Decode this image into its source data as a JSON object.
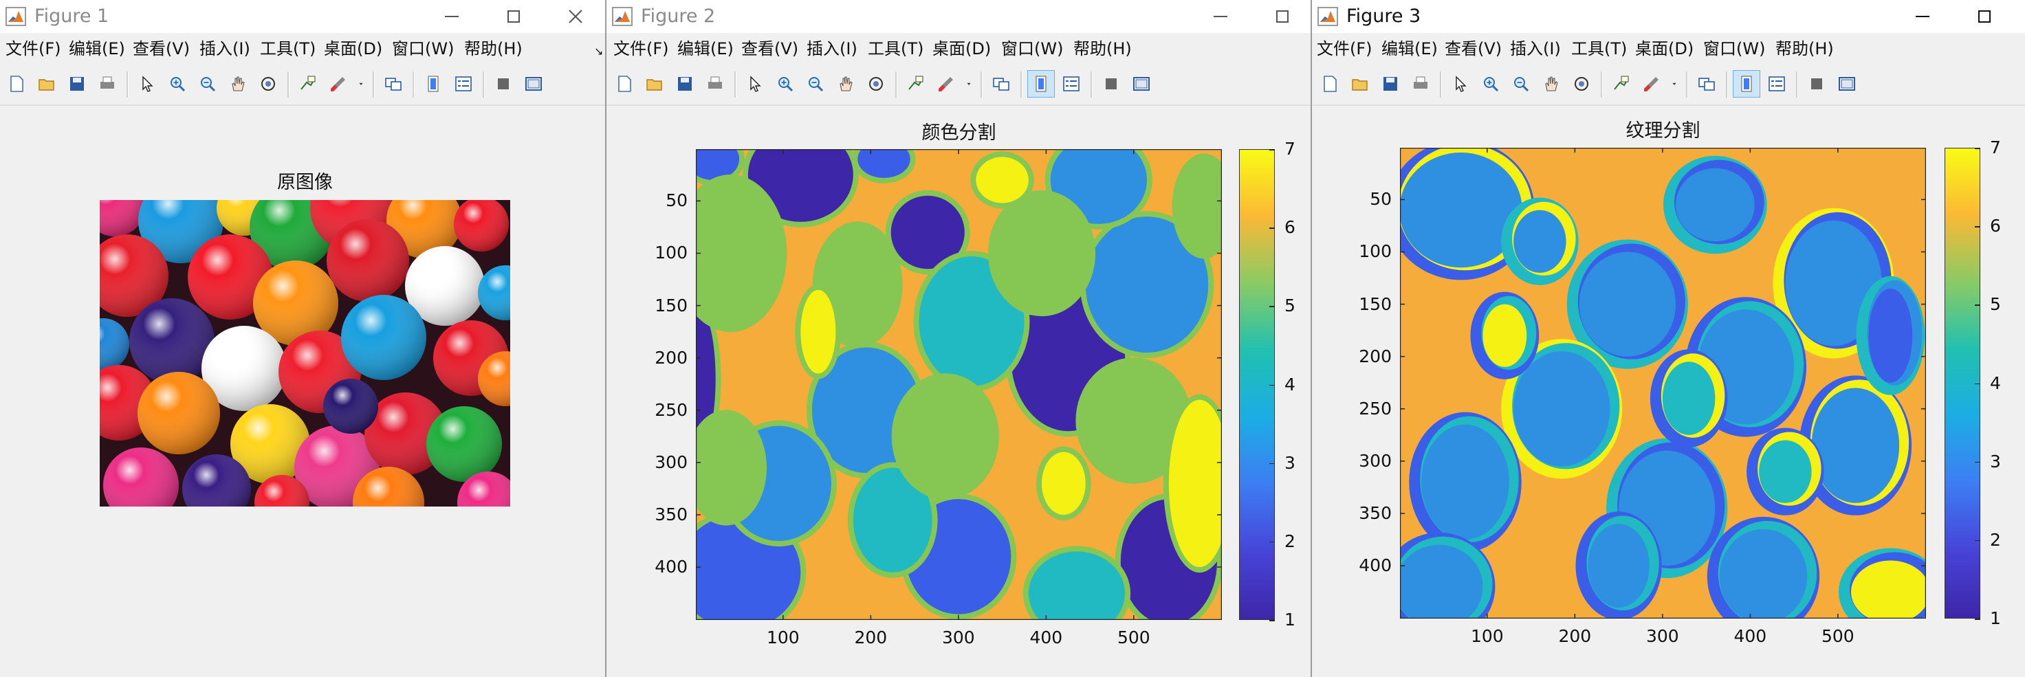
{
  "windows": {
    "figure1": {
      "title": "Figure 1",
      "state": "inactive",
      "menu": [
        "文件(F)",
        "编辑(E)",
        "查看(V)",
        "插入(I)",
        "工具(T)",
        "桌面(D)",
        "窗口(W)",
        "帮助(H)"
      ],
      "axes_title": "原图像"
    },
    "figure2": {
      "title": "Figure 2",
      "state": "inactive",
      "menu": [
        "文件(F)",
        "编辑(E)",
        "查看(V)",
        "插入(I)",
        "工具(T)",
        "桌面(D)",
        "窗口(W)",
        "帮助(H)"
      ],
      "axes_title": "颜色分割",
      "colorbar_ticks": [
        "7",
        "6",
        "5",
        "4",
        "3",
        "2",
        "1"
      ]
    },
    "figure3": {
      "title": "Figure 3",
      "state": "active",
      "menu": [
        "文件(F)",
        "编辑(E)",
        "查看(V)",
        "插入(I)",
        "工具(T)",
        "桌面(D)",
        "窗口(W)",
        "帮助(H)"
      ],
      "axes_title": "纹理分割",
      "colorbar_ticks": [
        "7",
        "6",
        "5",
        "4",
        "3",
        "2",
        "1"
      ]
    }
  },
  "toolbar_icons": [
    "new-figure-icon",
    "open-file-icon",
    "save-icon",
    "print-icon",
    "pointer-icon",
    "zoom-in-icon",
    "zoom-out-icon",
    "pan-icon",
    "rotate-3d-icon",
    "data-cursor-icon",
    "brush-icon",
    "brush-dropdown-icon",
    "link-plot-icon",
    "insert-colorbar-icon",
    "insert-legend-icon",
    "hide-plot-tools-icon",
    "show-plot-tools-icon"
  ],
  "colormap": {
    "1": "#3e26a8",
    "2": "#3b5ee8",
    "3": "#2f8fe0",
    "4": "#21b9c2",
    "5": "#86c652",
    "6": "#f5ac3a",
    "7": "#f5f213"
  },
  "chart_data": [
    {
      "type": "heatmap",
      "title": "颜色分割",
      "xlabel": "",
      "ylabel": "",
      "xticks": [
        "100",
        "200",
        "300",
        "400",
        "500"
      ],
      "yticks": [
        "50",
        "100",
        "150",
        "200",
        "250",
        "300",
        "350",
        "400"
      ],
      "xlim": [
        0.5,
        600.5
      ],
      "ylim": [
        0.5,
        450.5
      ],
      "colorbar": {
        "ticks": [
          1,
          2,
          3,
          4,
          5,
          6,
          7
        ],
        "range": [
          1,
          7
        ]
      },
      "background_label": 6,
      "regions": [
        {
          "label": 1,
          "cx": 120,
          "cy": 25,
          "rx": 60,
          "ry": 45
        },
        {
          "label": 1,
          "cx": 265,
          "cy": 80,
          "rx": 42,
          "ry": 35
        },
        {
          "label": 1,
          "cx": 425,
          "cy": 200,
          "rx": 65,
          "ry": 70
        },
        {
          "label": 1,
          "cx": 540,
          "cy": 395,
          "rx": 55,
          "ry": 60
        },
        {
          "label": 1,
          "cx": 5,
          "cy": 220,
          "rx": 18,
          "ry": 65
        },
        {
          "label": 2,
          "cx": 50,
          "cy": 405,
          "rx": 70,
          "ry": 55
        },
        {
          "label": 2,
          "cx": 300,
          "cy": 390,
          "rx": 60,
          "ry": 55
        },
        {
          "label": 2,
          "cx": 20,
          "cy": 10,
          "rx": 30,
          "ry": 20
        },
        {
          "label": 2,
          "cx": 215,
          "cy": 10,
          "rx": 30,
          "ry": 18
        },
        {
          "label": 3,
          "cx": 515,
          "cy": 130,
          "rx": 70,
          "ry": 65
        },
        {
          "label": 3,
          "cx": 195,
          "cy": 250,
          "rx": 62,
          "ry": 60
        },
        {
          "label": 3,
          "cx": 95,
          "cy": 320,
          "rx": 60,
          "ry": 55
        },
        {
          "label": 3,
          "cx": 460,
          "cy": 30,
          "rx": 55,
          "ry": 42
        },
        {
          "label": 4,
          "cx": 315,
          "cy": 165,
          "rx": 60,
          "ry": 62
        },
        {
          "label": 4,
          "cx": 225,
          "cy": 355,
          "rx": 45,
          "ry": 50
        },
        {
          "label": 4,
          "cx": 435,
          "cy": 425,
          "rx": 55,
          "ry": 40
        },
        {
          "label": 5,
          "cx": 40,
          "cy": 100,
          "rx": 58,
          "ry": 70
        },
        {
          "label": 5,
          "cx": 185,
          "cy": 130,
          "rx": 45,
          "ry": 55
        },
        {
          "label": 5,
          "cx": 395,
          "cy": 100,
          "rx": 55,
          "ry": 55
        },
        {
          "label": 5,
          "cx": 285,
          "cy": 275,
          "rx": 55,
          "ry": 55
        },
        {
          "label": 5,
          "cx": 500,
          "cy": 260,
          "rx": 60,
          "ry": 55
        },
        {
          "label": 5,
          "cx": 35,
          "cy": 305,
          "rx": 40,
          "ry": 50
        },
        {
          "label": 5,
          "cx": 580,
          "cy": 55,
          "rx": 30,
          "ry": 45
        },
        {
          "label": 7,
          "cx": 575,
          "cy": 320,
          "rx": 35,
          "ry": 80
        },
        {
          "label": 7,
          "cx": 140,
          "cy": 175,
          "rx": 20,
          "ry": 40
        },
        {
          "label": 7,
          "cx": 350,
          "cy": 30,
          "rx": 30,
          "ry": 22
        },
        {
          "label": 7,
          "cx": 420,
          "cy": 320,
          "rx": 25,
          "ry": 30
        }
      ]
    },
    {
      "type": "heatmap",
      "title": "纹理分割",
      "xlabel": "",
      "ylabel": "",
      "xticks": [
        "100",
        "200",
        "300",
        "400",
        "500"
      ],
      "yticks": [
        "50",
        "100",
        "150",
        "200",
        "250",
        "300",
        "350",
        "400"
      ],
      "xlim": [
        0.5,
        600.5
      ],
      "ylim": [
        0.5,
        450.5
      ],
      "colorbar": {
        "ticks": [
          1,
          2,
          3,
          4,
          5,
          6,
          7
        ],
        "range": [
          1,
          7
        ]
      },
      "background_label": 6,
      "regions": [
        {
          "label": 3,
          "cx": 70,
          "cy": 60,
          "rx": 70,
          "ry": 55,
          "ring": [
            2,
            7
          ]
        },
        {
          "label": 3,
          "cx": 260,
          "cy": 150,
          "rx": 55,
          "ry": 50,
          "ring": [
            4,
            2
          ]
        },
        {
          "label": 3,
          "cx": 495,
          "cy": 130,
          "rx": 55,
          "ry": 60,
          "ring": [
            7,
            2
          ]
        },
        {
          "label": 3,
          "cx": 185,
          "cy": 250,
          "rx": 55,
          "ry": 55,
          "ring": [
            7,
            4
          ]
        },
        {
          "label": 3,
          "cx": 395,
          "cy": 210,
          "rx": 55,
          "ry": 55,
          "ring": [
            2,
            4
          ]
        },
        {
          "label": 3,
          "cx": 75,
          "cy": 320,
          "rx": 50,
          "ry": 55,
          "ring": [
            2,
            4
          ]
        },
        {
          "label": 3,
          "cx": 305,
          "cy": 345,
          "rx": 55,
          "ry": 55,
          "ring": [
            4,
            2
          ]
        },
        {
          "label": 3,
          "cx": 520,
          "cy": 285,
          "rx": 50,
          "ry": 55,
          "ring": [
            2,
            7
          ]
        },
        {
          "label": 3,
          "cx": 45,
          "cy": 420,
          "rx": 50,
          "ry": 40,
          "ring": [
            2,
            4
          ]
        },
        {
          "label": 3,
          "cx": 415,
          "cy": 410,
          "rx": 50,
          "ry": 45,
          "ring": [
            2,
            4
          ]
        },
        {
          "label": 3,
          "cx": 160,
          "cy": 90,
          "rx": 30,
          "ry": 30,
          "ring": [
            4,
            7
          ]
        },
        {
          "label": 3,
          "cx": 360,
          "cy": 55,
          "rx": 45,
          "ry": 35,
          "ring": [
            4,
            2
          ]
        },
        {
          "label": 3,
          "cx": 250,
          "cy": 400,
          "rx": 35,
          "ry": 40,
          "ring": [
            2,
            4
          ]
        },
        {
          "label": 7,
          "cx": 560,
          "cy": 425,
          "rx": 45,
          "ry": 30,
          "ring": [
            4,
            2
          ]
        },
        {
          "label": 7,
          "cx": 120,
          "cy": 180,
          "rx": 25,
          "ry": 30,
          "ring": [
            2,
            4
          ]
        },
        {
          "label": 4,
          "cx": 330,
          "cy": 240,
          "rx": 30,
          "ry": 35,
          "ring": [
            2,
            7
          ]
        },
        {
          "label": 2,
          "cx": 560,
          "cy": 180,
          "rx": 25,
          "ry": 45,
          "ring": [
            4,
            3
          ]
        },
        {
          "label": 4,
          "cx": 440,
          "cy": 310,
          "rx": 30,
          "ry": 30,
          "ring": [
            2,
            7
          ]
        }
      ]
    }
  ]
}
